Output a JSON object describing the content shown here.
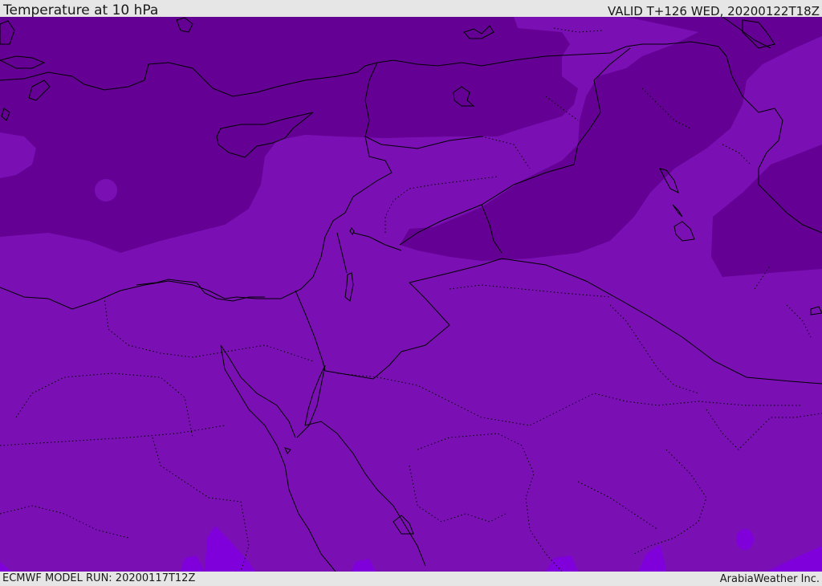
{
  "header": {
    "title": "Temperature at 10 hPa",
    "valid_time": "VALID T+126 WED, 20200122T18Z"
  },
  "footer": {
    "model_run": "ECMWF MODEL RUN: 20200117T12Z",
    "brand": "ArabiaWeather Inc."
  },
  "colors": {
    "field_base": "#7a10b4",
    "field_cold": "#640094",
    "field_warm": "#8000dc",
    "coastline": "#000000",
    "borders": "#000000"
  }
}
